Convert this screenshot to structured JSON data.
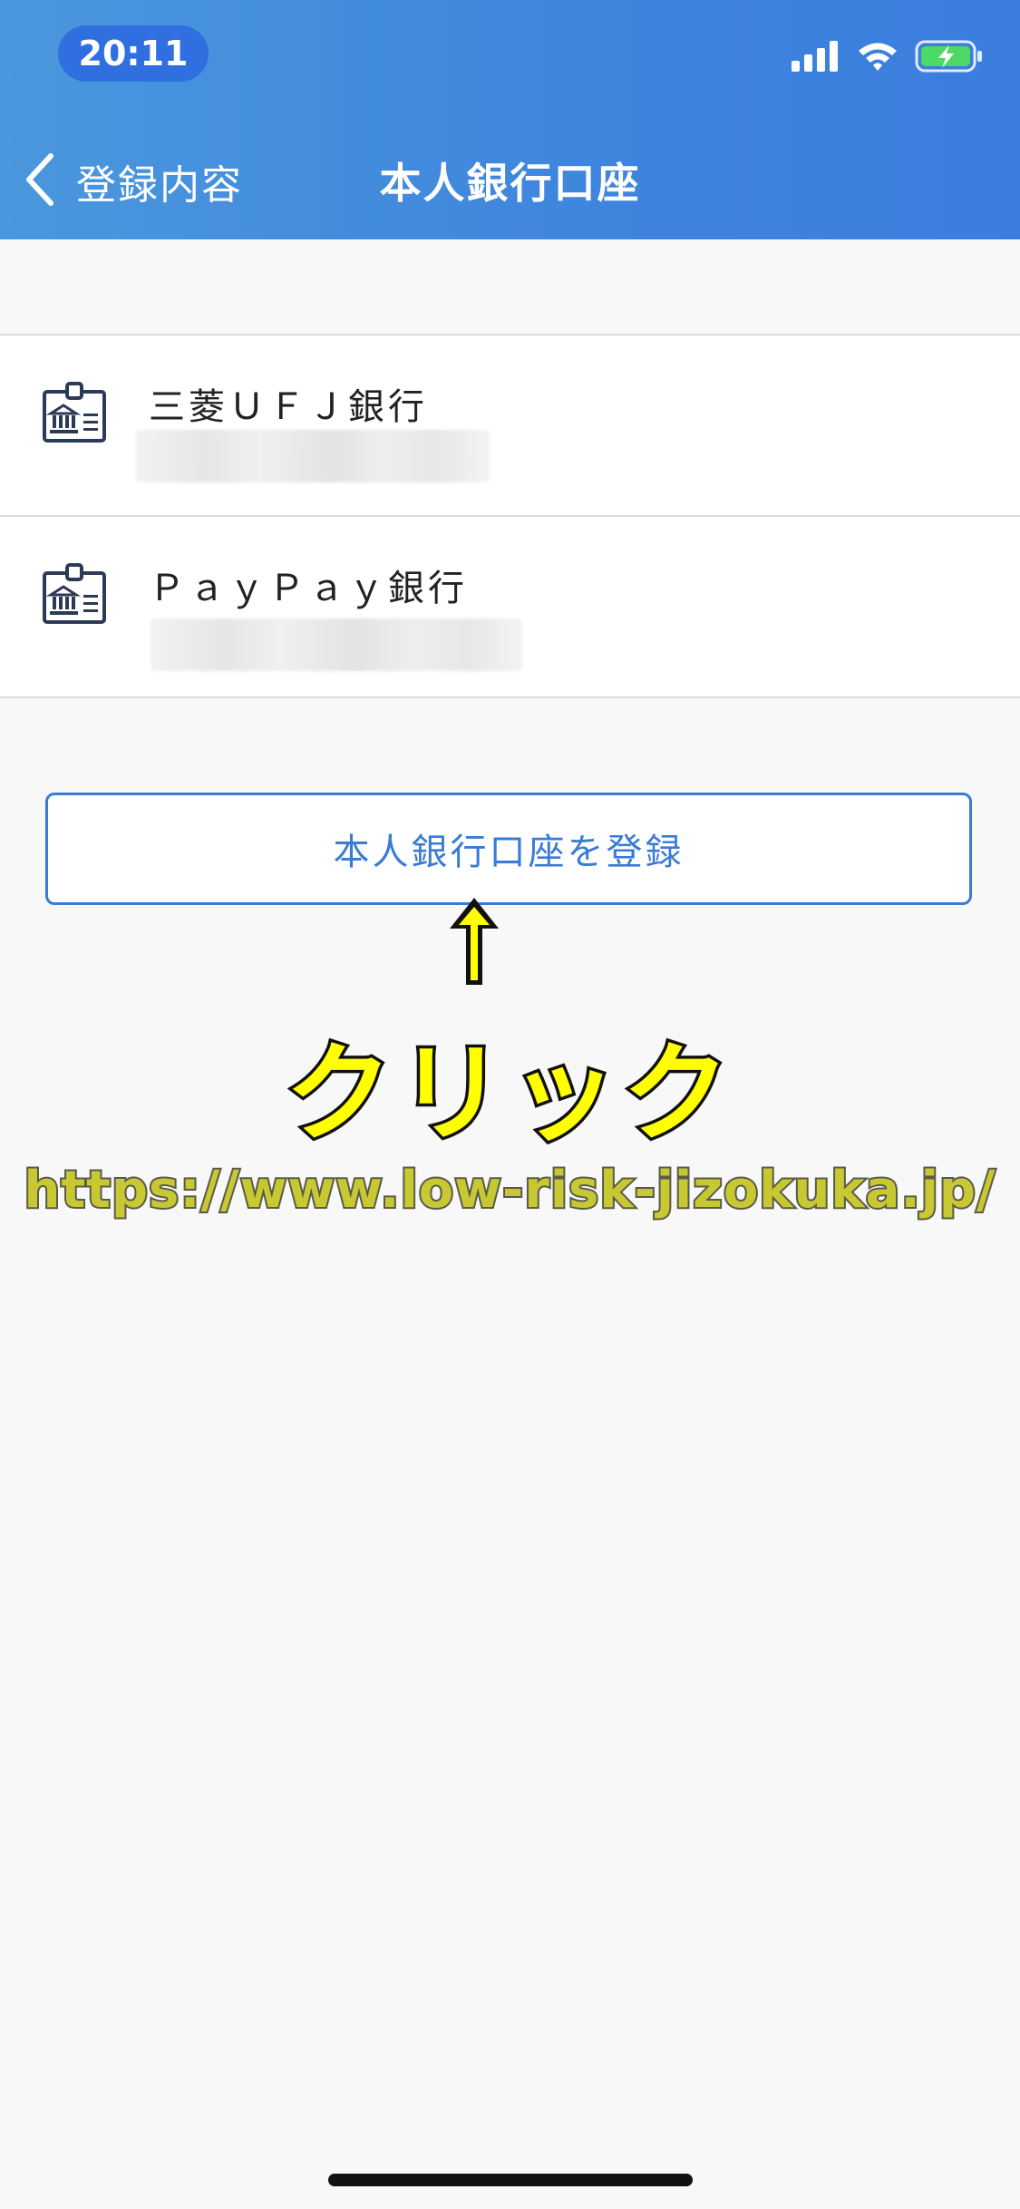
{
  "status_bar": {
    "time": "20:11"
  },
  "nav": {
    "back_label": "登録内容",
    "title": "本人銀行口座"
  },
  "bank_accounts": [
    {
      "name": "三菱ＵＦＪ銀行"
    },
    {
      "name": "ＰａｙＰａｙ銀行"
    }
  ],
  "register_button": {
    "label": "本人銀行口座を登録"
  },
  "annotation": {
    "text": "クリック"
  },
  "watermark": {
    "text": "https://www.low-risk-jizokuka.jp/"
  },
  "colors": {
    "header_start": "#4a97dd",
    "header_end": "#3b7ddf",
    "accent": "#3a7bd5",
    "annotation": "#ffff00"
  },
  "icons": [
    "chevron-left-icon",
    "bank-card-icon",
    "cellular-signal-icon",
    "wifi-icon",
    "battery-charging-icon",
    "arrow-up-icon"
  ]
}
